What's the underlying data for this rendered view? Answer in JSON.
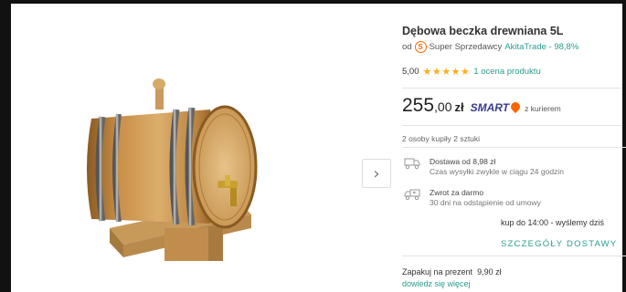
{
  "product": {
    "title": "Dębowa beczka drewniana 5L",
    "seller_prefix": "od",
    "seller_badge": "S",
    "seller_label": "Super Sprzedawcy",
    "seller_name": "AkitaTrade - 98,8%",
    "rating_value": "5,00",
    "stars": "★★★★★",
    "rating_count": "1 ocena produktu",
    "price_int": "255",
    "price_frac": ",00",
    "currency": "zł",
    "smart_label": "SMART",
    "smart_suffix": "z kurierem",
    "bought_info": "2 osoby kupiły 2 sztuki"
  },
  "shipping": {
    "delivery_title": "Dostawa od 8,98 zł",
    "delivery_sub": "Czas wysyłki zwykle w ciągu 24 godzin",
    "return_title": "Zwrot za darmo",
    "return_sub": "30 dni na odstąpienie od umowy",
    "cutoff": "kup do 14:00 - wyślemy dziś",
    "details_link": "SZCZEGÓŁY DOSTAWY"
  },
  "gift": {
    "label": "Zapakuj na prezent",
    "price": "9,90 zł",
    "link": "dowiedz się więcej"
  },
  "gallery": {
    "next_glyph": "›"
  },
  "colors": {
    "accent_green": "#2a9d8f",
    "star": "#fbae1a",
    "smart": "#3b3b8f",
    "orange": "#ff6600"
  }
}
